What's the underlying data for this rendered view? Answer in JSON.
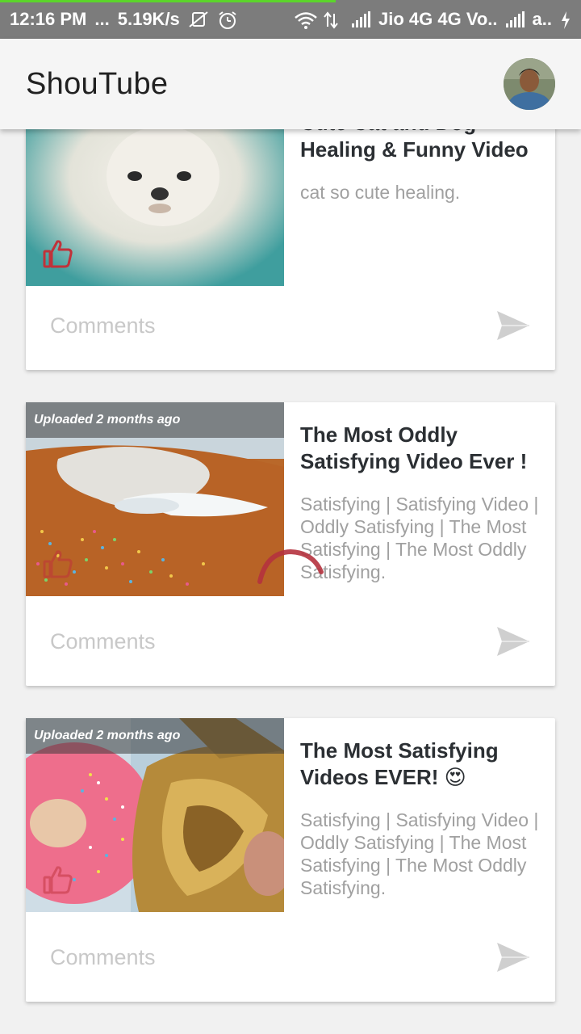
{
  "status_bar": {
    "time": "12:16 PM",
    "dots": "...",
    "speed": "5.19K/s",
    "carrier1": "Jio 4G 4G Vo..",
    "carrier2": "a.."
  },
  "app_bar": {
    "title": "ShouTube"
  },
  "videos": [
    {
      "title": "Cute Cat and Dog Healing & Funny Video",
      "description": "cat so cute healing.",
      "uploaded": "",
      "comments_placeholder": "Comments"
    },
    {
      "title": "The Most Oddly Satisfying Video Ever !",
      "description": "Satisfying | Satisfying Video | Oddly Satisfying | The Most Satisfying | The Most Oddly Satisfying.",
      "uploaded": "Uploaded 2 months ago",
      "comments_placeholder": "Comments"
    },
    {
      "title": "The Most Satisfying Videos EVER! 😍",
      "description": "Satisfying | Satisfying Video | Oddly Satisfying | The Most Satisfying | The Most Oddly Satisfying.",
      "uploaded": "Uploaded 2 months ago",
      "comments_placeholder": "Comments"
    }
  ],
  "colors": {
    "accent_like": "#c0323a",
    "send_icon": "#cfcfcf",
    "appbar_bg": "#f5f5f5",
    "status_bar_bg": "#7c7c7c"
  }
}
